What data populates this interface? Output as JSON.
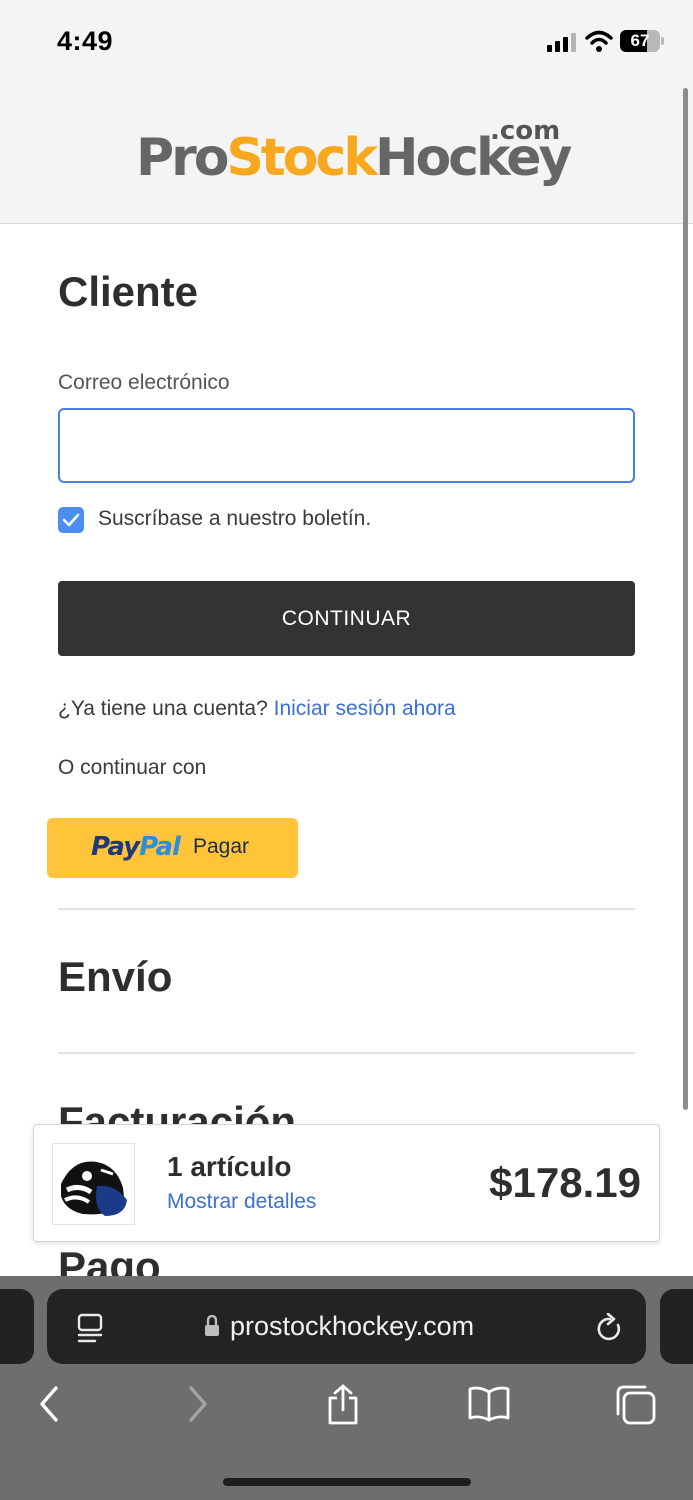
{
  "status_bar": {
    "time": "4:49",
    "battery": "67",
    "battery_level": 0.67
  },
  "header": {
    "logo_pro": "Pro",
    "logo_stock": "Stock",
    "logo_hockey": "Hockey",
    "logo_dotcom": ".com"
  },
  "customer": {
    "title": "Cliente",
    "email_label": "Correo electrónico",
    "email_value": "",
    "newsletter_label": "Suscríbase a nuestro boletín.",
    "newsletter_checked": true,
    "continue_label": "CONTINUAR",
    "have_account": "¿Ya tiene una cuenta?",
    "sign_in_link": "Iniciar sesión ahora",
    "or_continue": "O continuar con",
    "paypal_pay": "Pay",
    "paypal_pal": "Pal",
    "paypal_label": "Pagar"
  },
  "sections": {
    "shipping": "Envío",
    "billing": "Facturación",
    "payment": "Pago"
  },
  "cart": {
    "count": "1 artículo",
    "details_link": "Mostrar detalles",
    "total": "$178.19"
  },
  "browser": {
    "url": "prostockhockey.com"
  },
  "colors": {
    "accent": "#4b7fe0",
    "link": "#3a6fd6",
    "brand_orange": "#f7a81f",
    "paypal_yellow": "#ffc43a",
    "button_dark": "#333333"
  }
}
